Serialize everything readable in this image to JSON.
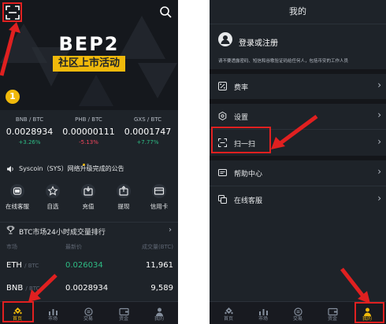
{
  "left": {
    "banner": {
      "headline": "BEP2",
      "subtitle": "社区上市活动",
      "index_badge": "1"
    },
    "tickers": [
      {
        "pair": "BNB / BTC",
        "price": "0.0028934",
        "change": "+3.26%",
        "dir": "up"
      },
      {
        "pair": "PHB / BTC",
        "price": "0.00000111",
        "change": "-5.13%",
        "dir": "down"
      },
      {
        "pair": "GXS / BTC",
        "price": "0.0001747",
        "change": "+7.77%",
        "dir": "up"
      }
    ],
    "notice": "Syscoin（SYS）网络升级完成的公告",
    "quick_actions": [
      {
        "label": "在线客服",
        "icon": "headset-icon"
      },
      {
        "label": "自选",
        "icon": "star-icon"
      },
      {
        "label": "充值",
        "icon": "deposit-icon"
      },
      {
        "label": "提现",
        "icon": "withdraw-icon"
      },
      {
        "label": "信用卡",
        "icon": "credit-card-icon"
      }
    ],
    "ranking_title": "BTC市场24小时成交量排行",
    "market_headers": {
      "market": "市场",
      "last": "最新价",
      "volume": "成交量(BTC)"
    },
    "market_rows": [
      {
        "base": "ETH",
        "quote": "/ BTC",
        "last": "0.026034",
        "volume": "11,961"
      },
      {
        "base": "BNB",
        "quote": "/ BTC",
        "last": "0.0028934",
        "volume": "9,589"
      }
    ],
    "tabs": [
      {
        "label": "首页",
        "icon": "home-icon"
      },
      {
        "label": "市场",
        "icon": "market-icon"
      },
      {
        "label": "交易",
        "icon": "trade-icon"
      },
      {
        "label": "资金",
        "icon": "wallet-icon"
      },
      {
        "label": "我的",
        "icon": "profile-icon"
      }
    ]
  },
  "right": {
    "title": "我的",
    "login_label": "登录或注册",
    "warning": "请不要透露密码、短信和谷歌验证码给任何人，包括币安的工作人员",
    "menu": [
      {
        "label": "费率",
        "icon": "percent-icon"
      },
      {
        "label": "设置",
        "icon": "settings-icon"
      },
      {
        "label": "扫一扫",
        "icon": "scan-icon"
      },
      {
        "label": "帮助中心",
        "icon": "help-icon"
      },
      {
        "label": "在线客服",
        "icon": "chat-icon"
      }
    ],
    "tabs": [
      {
        "label": "首页",
        "icon": "home-icon"
      },
      {
        "label": "市场",
        "icon": "market-icon"
      },
      {
        "label": "交易",
        "icon": "trade-icon"
      },
      {
        "label": "资金",
        "icon": "wallet-icon"
      },
      {
        "label": "我的",
        "icon": "profile-icon"
      }
    ]
  },
  "colors": {
    "accent": "#f0b90b",
    "up": "#2ebd85",
    "down": "#f6465d",
    "bg": "#1e2329",
    "highlight": "#e02020"
  }
}
